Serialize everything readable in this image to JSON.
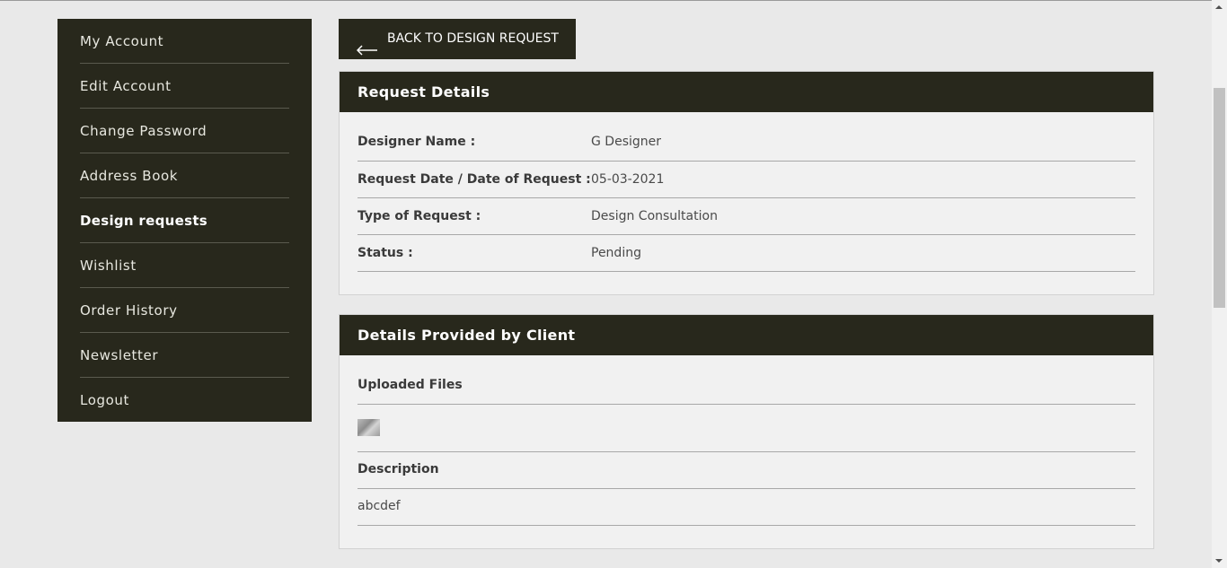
{
  "sidebar": {
    "items": [
      {
        "label": "My Account"
      },
      {
        "label": "Edit Account"
      },
      {
        "label": "Change Password"
      },
      {
        "label": "Address Book"
      },
      {
        "label": "Design requests",
        "active": true
      },
      {
        "label": "Wishlist"
      },
      {
        "label": "Order History"
      },
      {
        "label": "Newsletter"
      },
      {
        "label": "Logout"
      }
    ]
  },
  "back_button": {
    "label": "BACK TO DESIGN REQUEST",
    "icon": "arrow-left-icon"
  },
  "request_details": {
    "title": "Request Details",
    "rows": [
      {
        "label": "Designer Name :",
        "value": "G Designer"
      },
      {
        "label": "Request Date / Date of Request :",
        "value": "05-03-2021"
      },
      {
        "label": "Type of Request :",
        "value": "Design Consultation"
      },
      {
        "label": "Status :",
        "value": "Pending"
      }
    ]
  },
  "client_details": {
    "title": "Details Provided by Client",
    "uploaded_files_label": "Uploaded Files",
    "description_label": "Description",
    "description": "abcdef"
  },
  "colors": {
    "dark": "#28281c",
    "background": "#e9e9e9",
    "panel": "#f1f1f1"
  }
}
